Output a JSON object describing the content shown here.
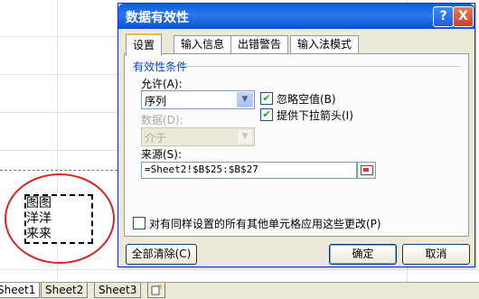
{
  "spreadsheet": {
    "cells": [
      "图图",
      "洋洋",
      "来来"
    ],
    "sheet_tabs": [
      {
        "label": "Sheet1",
        "active": true
      },
      {
        "label": "Sheet2",
        "active": false
      },
      {
        "label": "Sheet3",
        "active": false
      }
    ]
  },
  "dialog": {
    "title": "数据有效性",
    "help_label": "?",
    "close_label": "X",
    "tabs": [
      "设置",
      "输入信息",
      "出错警告",
      "输入法模式"
    ],
    "group_title": "有效性条件",
    "allow_label": "允许(A):",
    "allow_value": "序列",
    "data_label": "数据(D):",
    "data_value": "介于",
    "ignore_blank_label": "忽略空值(B)",
    "ignore_blank_checked": true,
    "dropdown_label": "提供下拉箭头(I)",
    "dropdown_checked": true,
    "source_label": "来源(S):",
    "source_value": "=Sheet2!$B$25:$B$27",
    "apply_all_label": "对有同样设置的所有其他单元格应用这些更改(P)",
    "apply_all_checked": false,
    "clear_all_label": "全部清除(C)",
    "ok_label": "确定",
    "cancel_label": "取消",
    "check_mark": "✔"
  },
  "colors": {
    "title_bar": "#0a5fdc",
    "annotation_circle": "#d82424",
    "group_title": "#0046d5"
  }
}
